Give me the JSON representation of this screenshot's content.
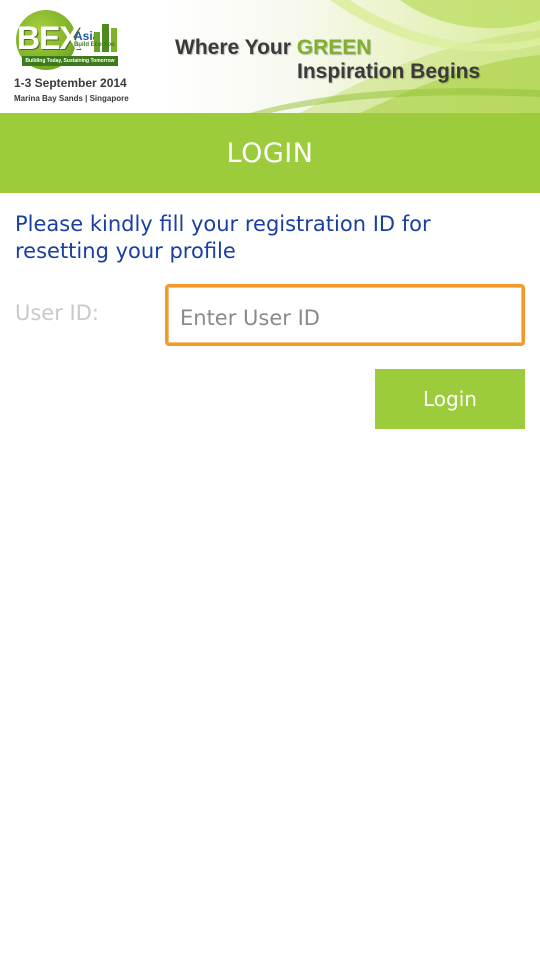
{
  "banner": {
    "logo": {
      "brand": "BEX",
      "region": "Asia",
      "subtitle": "Build Eco Xpo",
      "motto": "Building Today, Sustaining Tomorrow",
      "date": "1-3 September 2014",
      "venue": "Marina Bay Sands | Singapore"
    },
    "tagline": {
      "line1_prefix": "Where Your ",
      "line1_highlight": "GREEN",
      "line2": "Inspiration Begins"
    }
  },
  "title_bar": {
    "title": "LOGIN"
  },
  "form": {
    "instruction": "Please kindly fill your registration ID for resetting your profile",
    "user_id_label": "User ID:",
    "user_id_placeholder": "Enter User ID",
    "user_id_value": "",
    "submit_label": "Login"
  },
  "colors": {
    "accent_green": "#9ccb3b",
    "instruction_blue": "#1a3fa0",
    "focus_orange": "#f39a28"
  }
}
